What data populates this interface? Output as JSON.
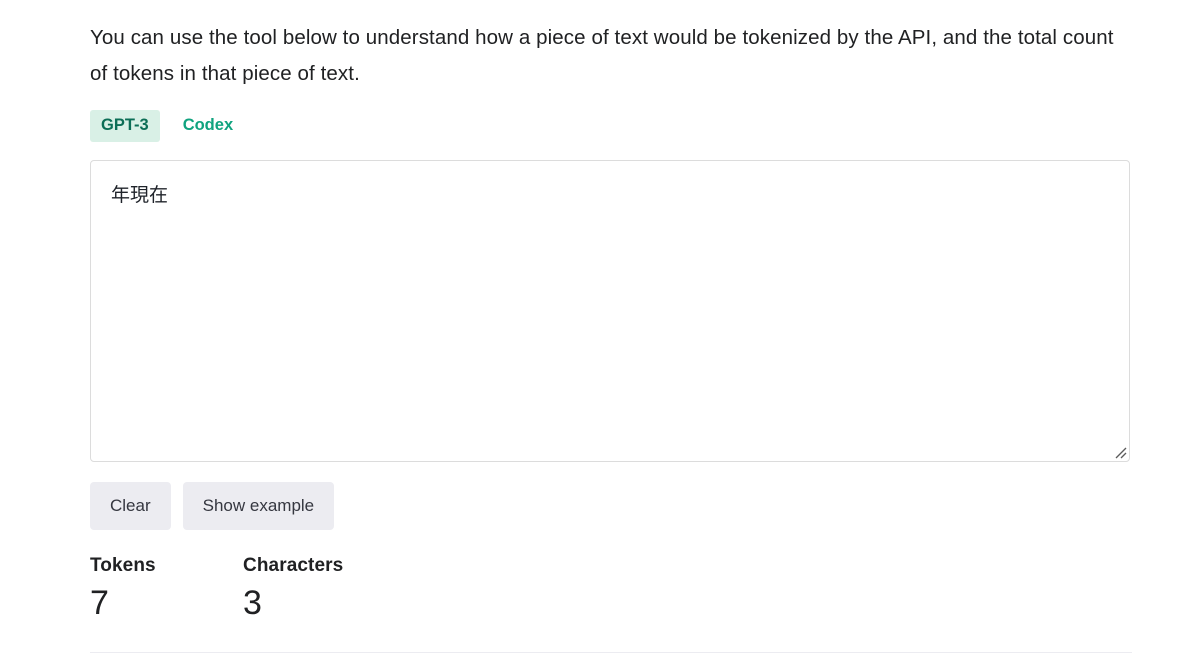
{
  "intro": {
    "paragraph": "You can use the tool below to understand how a piece of text would be tokenized by the API, and the total count of tokens in that piece of text."
  },
  "tabs": {
    "items": [
      {
        "label": "GPT-3",
        "active": true
      },
      {
        "label": "Codex",
        "active": false
      }
    ],
    "active_label": "GPT-3",
    "inactive_label": "Codex",
    "active_bg": "#d9f0e6",
    "active_color": "#0c6e56",
    "inactive_color": "#10a37f"
  },
  "editor": {
    "value": "年現在",
    "placeholder": "Enter some text",
    "resize_handle": "resize-grip-icon"
  },
  "actions": {
    "clear_label": "Clear",
    "show_example_label": "Show example"
  },
  "stats": {
    "tokens_label": "Tokens",
    "tokens_value": "7",
    "characters_label": "Characters",
    "characters_value": "3"
  }
}
